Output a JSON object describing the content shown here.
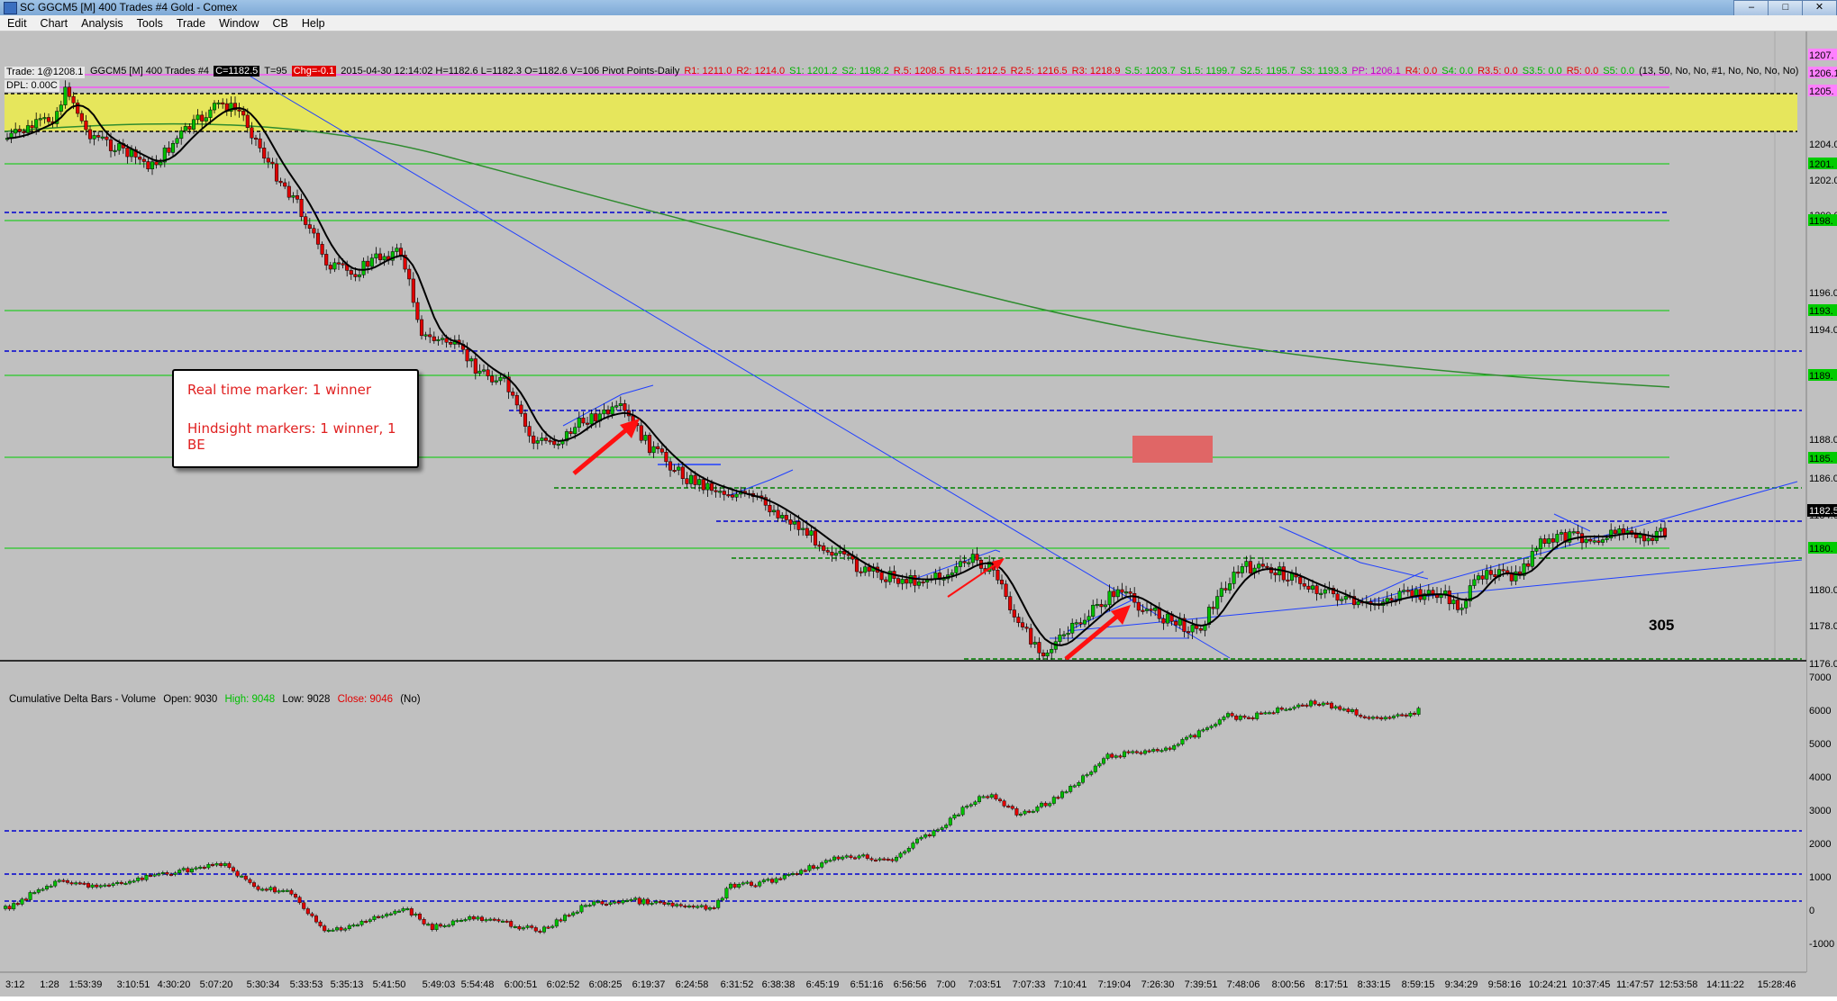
{
  "window": {
    "title": "SC GGCM5 [M]  400 Trades  #4  Gold - Comex",
    "buttons": [
      "–",
      "□",
      "✕"
    ]
  },
  "menu": [
    "Edit",
    "Chart",
    "Analysis",
    "Tools",
    "Trade",
    "Window",
    "CB",
    "Help"
  ],
  "chart_header": {
    "trade": "Trade: 1@1208.1",
    "dpl": "DPL: 0.00C",
    "symbol": "GGCM5 [M]  400 Trades  #4",
    "close_box": "C=1182.5",
    "t_count": "T=95",
    "chg": "Chg=-0.1",
    "ohlc": "2015-04-30 12:14:02 H=1182.6 L=1182.3 O=1182.6 V=106 Pivot Points-Daily",
    "pivots": [
      {
        "text": "R1: 1211.0",
        "color": "#e00000"
      },
      {
        "text": "R2: 1214.0",
        "color": "#e00000"
      },
      {
        "text": "S1: 1201.2",
        "color": "#00b000"
      },
      {
        "text": "S2: 1198.2",
        "color": "#00b000"
      },
      {
        "text": "R.5: 1208.5",
        "color": "#e00000"
      },
      {
        "text": "R1.5: 1212.5",
        "color": "#e00000"
      },
      {
        "text": "R2.5: 1216.5",
        "color": "#e00000"
      },
      {
        "text": "R3: 1218.9",
        "color": "#e00000"
      },
      {
        "text": "S.5: 1203.7",
        "color": "#00b000"
      },
      {
        "text": "S1.5: 1199.7",
        "color": "#00b000"
      },
      {
        "text": "S2.5: 1195.7",
        "color": "#00b000"
      },
      {
        "text": "S3: 1193.3",
        "color": "#00b000"
      },
      {
        "text": "PP: 1206.1",
        "color": "#c000c0"
      },
      {
        "text": "R4: 0.0",
        "color": "#e00000"
      },
      {
        "text": "S4: 0.0",
        "color": "#00b000"
      },
      {
        "text": "R3.5: 0.0",
        "color": "#e00000"
      },
      {
        "text": "S3.5: 0.0",
        "color": "#00b000"
      },
      {
        "text": "R5: 0.0",
        "color": "#e00000"
      },
      {
        "text": "S5: 0.0",
        "color": "#00b000"
      },
      {
        "text": "(13, 50, No, No, #1, No, No, No, No)",
        "color": "#000000"
      }
    ]
  },
  "annotation": {
    "line1": "Real time marker: 1 winner",
    "line2": "Hindsight markers: 1 winner, 1 BE"
  },
  "bar_count_label": "305",
  "price_axis": {
    "labels": [
      "1204.0",
      "1202.0",
      "1200.0",
      "1196.0",
      "1194.0",
      "1188.0",
      "1186.0",
      "1184.0",
      "1180.0",
      "1178.0",
      "1176.0"
    ],
    "cursor_price": "1182.5",
    "markers": [
      {
        "text": "1207.",
        "color": "#ff80ff"
      },
      {
        "text": "1206.1",
        "color": "#ff80ff"
      },
      {
        "text": "1205.",
        "color": "#ff80ff"
      },
      {
        "text": "1201.",
        "color": "#00cc00"
      },
      {
        "text": "1198.",
        "color": "#00cc00"
      },
      {
        "text": "1193.",
        "color": "#00cc00"
      },
      {
        "text": "1189.",
        "color": "#00cc00"
      },
      {
        "text": "1185.",
        "color": "#00cc00"
      },
      {
        "text": "1180.",
        "color": "#00cc00"
      }
    ]
  },
  "lower_panel": {
    "title": "Cumulative Delta Bars - Volume",
    "open": "Open: 9030",
    "high": "High: 9048",
    "low": "Low: 9028",
    "close": "Close: 9046",
    "flag": "(No)",
    "axis": [
      "7000",
      "6000",
      "5000",
      "4000",
      "3000",
      "2000",
      "1000",
      "0",
      "-1000"
    ]
  },
  "time_axis": [
    "3:12",
    "1:28",
    "1:53:39",
    "3:10:51",
    "4:30:20",
    "5:07:20",
    "5:30:34",
    "5:33:53",
    "5:35:13",
    "5:41:50",
    "5:49:03",
    "5:54:48",
    "6:00:51",
    "6:02:52",
    "6:08:25",
    "6:19:37",
    "6:24:58",
    "6:31:52",
    "6:38:38",
    "6:45:19",
    "6:51:16",
    "6:56:56",
    "7:00",
    "7:03:51",
    "7:07:33",
    "7:10:41",
    "7:19:04",
    "7:26:30",
    "7:39:51",
    "7:48:06",
    "8:00:56",
    "8:17:51",
    "8:33:15",
    "8:59:15",
    "9:34:29",
    "9:58:16",
    "10:24:21",
    "10:37:45",
    "11:47:57",
    "12:53:58",
    "14:11:22",
    "15:28:46"
  ],
  "colors": {
    "chart_bg": "#c0c0c0",
    "up_candle": "#00c000",
    "down_candle": "#e00000",
    "pivot_yellow": "#e6e65c",
    "blue_dash": "#0000d0",
    "green_dash": "#008000"
  }
}
